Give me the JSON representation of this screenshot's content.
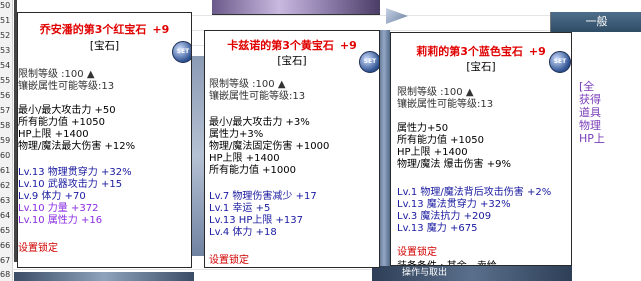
{
  "sheet": {
    "row_numbers": [
      "50",
      "51",
      "52",
      "53",
      "54",
      "55",
      "56",
      "57",
      "58",
      "59",
      "60",
      "61",
      "62",
      "63",
      "64",
      "65",
      "66",
      "67",
      "68"
    ]
  },
  "background": {
    "right_panel_title": "一般",
    "right_panel_text": [
      "[全",
      "获得",
      "道具",
      "物理",
      "HP上"
    ],
    "left_strip_text": [
      "]",
      "]"
    ],
    "bottom_text": "操作与取出"
  },
  "cards": [
    {
      "title": "乔安潘的第3个红宝石",
      "level": "+9",
      "subtitle": "[宝石]",
      "set_icon": "SET",
      "restrict": "限制等级 :100 ▲",
      "inlay": "镶嵌属性可能等级:13",
      "stats": [
        "最小/最大攻击力 +50",
        "所有能力值 +1050",
        "HP上限 +1400",
        "物理/魔法最大伤害 +12%"
      ],
      "skills": [
        {
          "text": "Lv.13 物理贯穿力 +32%",
          "color": "blue"
        },
        {
          "text": "Lv.10 武器攻击力 +15",
          "color": "blue"
        },
        {
          "text": "Lv.9 体力 +70",
          "color": "blue"
        },
        {
          "text": "Lv.10 力量 +372",
          "color": "purple"
        },
        {
          "text": "Lv.10 属性力 +16",
          "color": "purple"
        }
      ],
      "lock": "设置锁定"
    },
    {
      "title": "卡兹诺的第3个黄宝石",
      "level": "+9",
      "subtitle": "[宝石]",
      "set_icon": "SET",
      "restrict": "限制等级 :100 ▲",
      "inlay": "镶嵌属性可能等级:13",
      "stats": [
        "最小/最大攻击力 +3%",
        "属性力+3%",
        "物理/魔法固定伤害 +1000",
        "HP上限 +1400",
        "所有能力值 +1000"
      ],
      "skills": [
        {
          "text": "Lv.7 物理伤害减少 +17",
          "color": "blue"
        },
        {
          "text": "Lv.1 幸运 +5",
          "color": "blue"
        },
        {
          "text": "Lv.13 HP上限 +137",
          "color": "blue"
        },
        {
          "text": "Lv.4 体力 +18",
          "color": "blue"
        }
      ],
      "lock": "设置锁定"
    },
    {
      "title": "莉莉的第3个蓝色宝石",
      "level": "+9",
      "subtitle": "[宝石]",
      "set_icon": "SET",
      "restrict": "限制等级 :100 ▲",
      "inlay": "镶嵌属性可能等级:13",
      "stats": [
        "属性力+50",
        "所有能力值 +1050",
        "HP上限 +1400",
        "物理/魔法 爆击伤害 +9%"
      ],
      "skills": [
        {
          "text": "Lv.1 物理/魔法背后攻击伤害 +2%",
          "color": "blue"
        },
        {
          "text": "Lv.13 魔法贯穿力 +32%",
          "color": "blue"
        },
        {
          "text": "Lv.3 魔法抗力 +209",
          "color": "blue"
        },
        {
          "text": "Lv.13 魔力 +675",
          "color": "blue"
        }
      ],
      "lock": "设置锁定",
      "footer": "装备条件 : 其余 - 卖给"
    }
  ]
}
